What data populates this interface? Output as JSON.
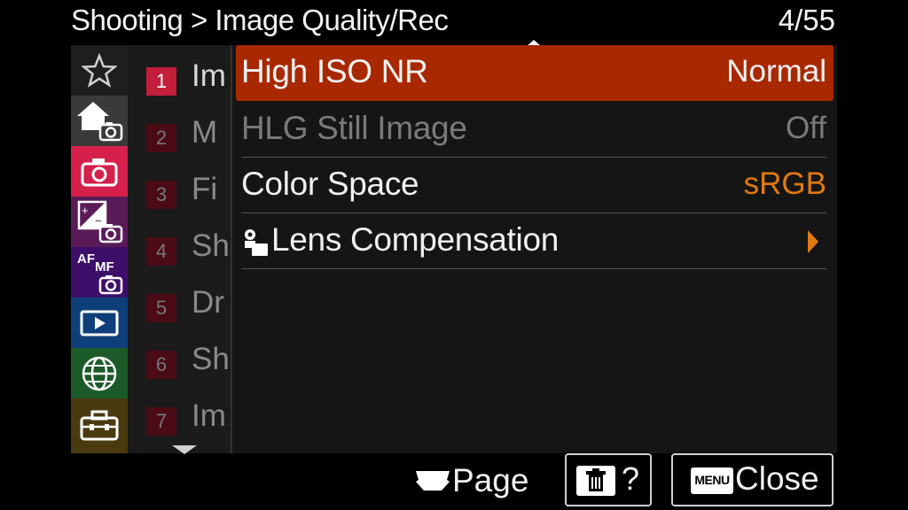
{
  "header": {
    "breadcrumb": "Shooting > Image Quality/Rec",
    "page_counter": "4/55"
  },
  "categories": [
    {
      "name": "favorites",
      "icon": "star-icon",
      "color": "#1e1e1e"
    },
    {
      "name": "main",
      "icon": "home-camera-icon",
      "color": "#3a3a3a"
    },
    {
      "name": "shooting",
      "icon": "camera-icon",
      "color": "#d6204c"
    },
    {
      "name": "exposure-color",
      "icon": "exposure-camera-icon",
      "color": "#5a1a58"
    },
    {
      "name": "focus",
      "icon": "af-mf-camera-icon",
      "color": "#3d0f6a"
    },
    {
      "name": "playback",
      "icon": "playback-icon",
      "color": "#0f3f7a"
    },
    {
      "name": "network",
      "icon": "globe-icon",
      "color": "#1c5a2a"
    },
    {
      "name": "setup",
      "icon": "toolbox-icon",
      "color": "#4a3a10"
    }
  ],
  "submenu": [
    {
      "num": "1",
      "label": "Im"
    },
    {
      "num": "2",
      "label": "M"
    },
    {
      "num": "3",
      "label": "Fi"
    },
    {
      "num": "4",
      "label": "Sh"
    },
    {
      "num": "5",
      "label": "Dr"
    },
    {
      "num": "6",
      "label": "Sh"
    },
    {
      "num": "7",
      "label": "Im"
    }
  ],
  "menu": {
    "items": [
      {
        "label": "High ISO NR",
        "value": "Normal",
        "state": "selected"
      },
      {
        "label": "HLG Still Image",
        "value": "Off",
        "state": "disabled"
      },
      {
        "label": "Color Space",
        "value": "sRGB",
        "state": "normal"
      },
      {
        "label": "Lens Compensation",
        "value": "",
        "state": "submenu"
      }
    ]
  },
  "footer": {
    "page_label": "Page",
    "help_label": "?",
    "menu_badge": "MENU",
    "close_label": "Close"
  },
  "colors": {
    "selected_row": "#a82800",
    "active_category": "#d6204c",
    "value_orange": "#e07a10"
  }
}
